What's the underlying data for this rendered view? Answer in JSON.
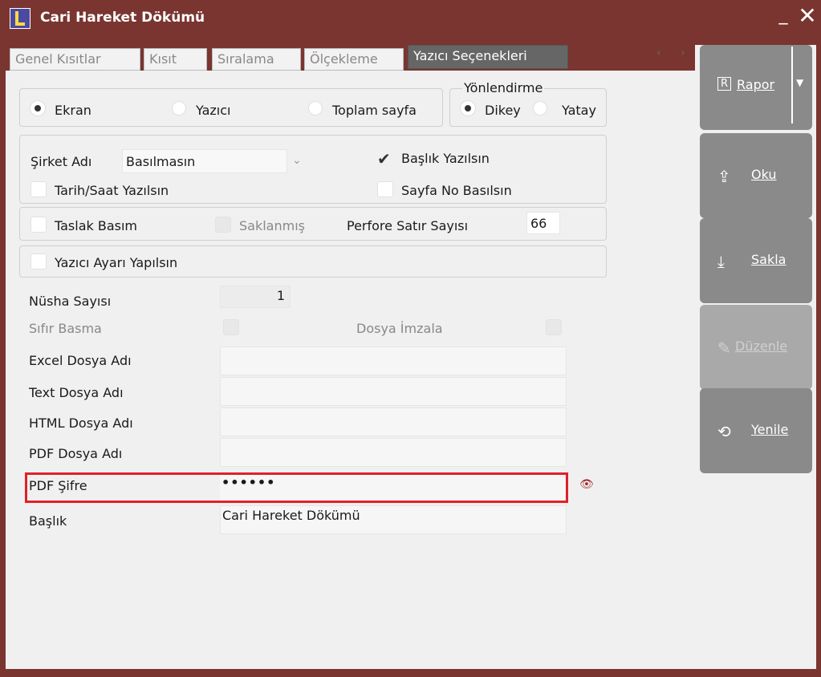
{
  "window": {
    "title": "Cari Hareket Dökümü",
    "minimize": "_",
    "close": "✕"
  },
  "tabs": [
    {
      "label": "Genel Kısıtlar"
    },
    {
      "label": "Kısıt"
    },
    {
      "label": "Sıralama"
    },
    {
      "label": "Ölçekleme"
    },
    {
      "label": "Yazıcı Seçenekleri",
      "active": true
    }
  ],
  "tab_scroll": {
    "left": "‹",
    "right": "›"
  },
  "output": {
    "ekran": "Ekran",
    "yazici": "Yazıcı",
    "toplam_sayfa": "Toplam sayfa",
    "selected": "Ekran"
  },
  "orientation": {
    "legend": "Yönlendirme",
    "dikey": "Dikey",
    "yatay": "Yatay",
    "selected": "Dikey"
  },
  "company": {
    "label": "Şirket Adı",
    "value": "Basılmasın",
    "baslik_yazilsin": "Başlık Yazılsın",
    "baslik_checked": true,
    "tarih_saat": "Tarih/Saat Yazılsın",
    "sayfa_no": "Sayfa No Basılsın"
  },
  "print_opts": {
    "taslak_basim": "Taslak Basım",
    "saklanmis": "Saklanmış",
    "perfore_label": "Perfore Satır Sayısı",
    "perfore_value": "66",
    "yazici_ayari": "Yazıcı Ayarı Yapılsın"
  },
  "form": {
    "nusha_label": "Nüsha Sayısı",
    "nusha_value": "1",
    "sifir_basma": "Sıfır Basma",
    "dosya_imzala": "Dosya İmzala",
    "excel_label": "Excel Dosya Adı",
    "text_label": "Text Dosya Adı",
    "html_label": "HTML Dosya Adı",
    "pdf_label": "PDF Dosya Adı",
    "pdf_sifre_label": "PDF Şifre",
    "pdf_sifre_value": "••••••",
    "baslik_label": "Başlık",
    "baslik_value": "Cari Hareket Dökümü"
  },
  "side_buttons": {
    "rapor": "Rapor",
    "oku": "Oku",
    "sakla": "Sakla",
    "duzenle": "Düzenle",
    "yenile": "Yenile"
  },
  "colors": {
    "frame": "#7a3530",
    "highlight": "#e0202a",
    "side_button": "#8a8a8a"
  }
}
